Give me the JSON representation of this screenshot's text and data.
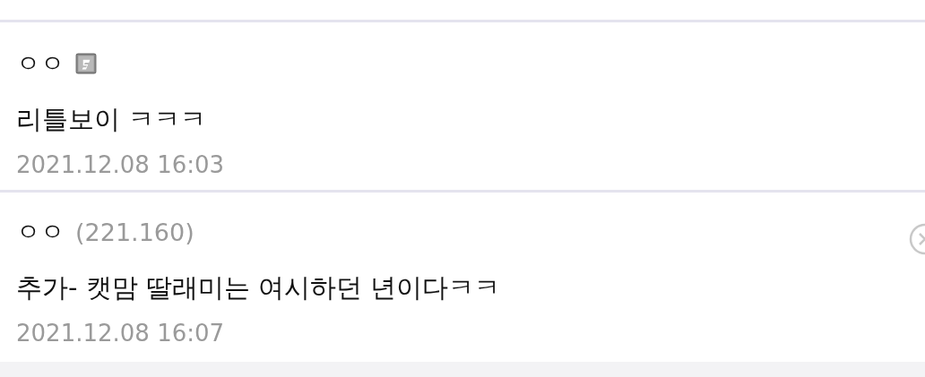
{
  "comments": [
    {
      "name": "ㅇㅇ",
      "fixed_member": true,
      "text": "리틀보이 ㅋㅋㅋ",
      "date": "2021.12.08 16:03",
      "deletable": false
    },
    {
      "name": "ㅇㅇ",
      "fixed_member": false,
      "ip": "(221.160)",
      "text": "추가- 캣맘 딸래미는 여시하던 년이다ㅋㅋ",
      "date": "2021.12.08 16:07",
      "deletable": true
    }
  ]
}
